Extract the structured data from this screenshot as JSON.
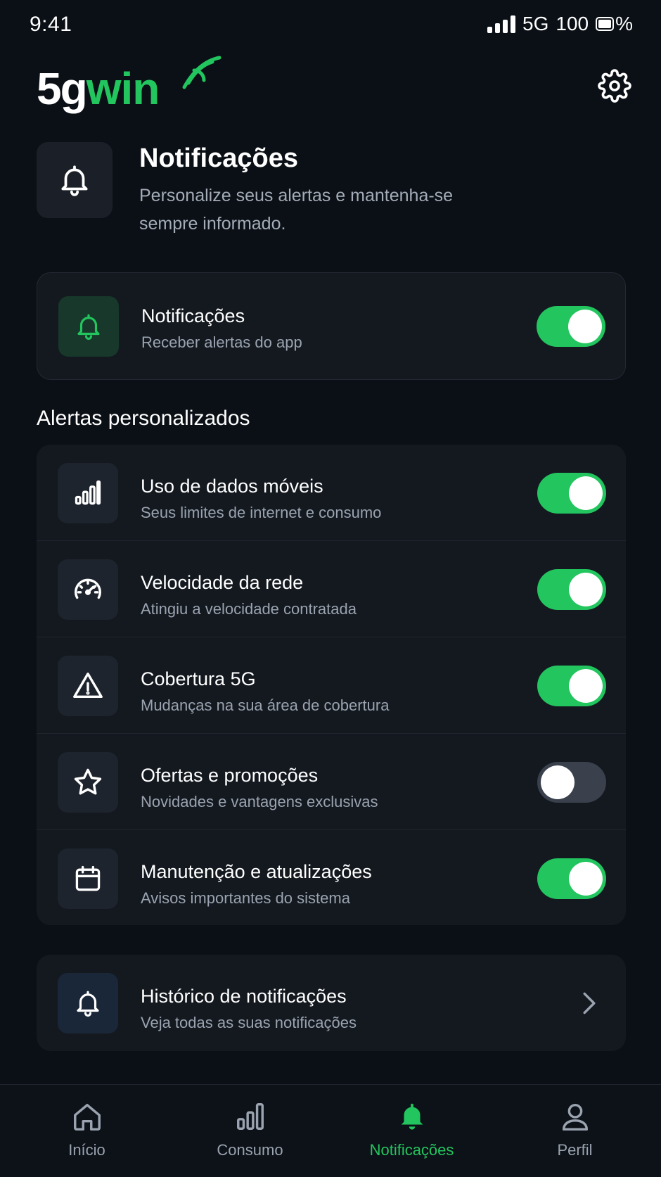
{
  "status_bar": {
    "time": "9:41",
    "network": "5G",
    "battery": "100",
    "battery_suffix": "%"
  },
  "brand": {
    "logo_part1": "5g",
    "logo_part2": "win",
    "accent_color": "#22c55e"
  },
  "header": {
    "title": "Notificações",
    "subtitle": "Personalize seus alertas e mantenha-se sempre informado."
  },
  "master": {
    "title": "Notificações",
    "subtitle": "Receber alertas do app",
    "enabled": true
  },
  "section_title": "Alertas personalizados",
  "alerts": [
    {
      "icon": "signal-bars-icon",
      "title": "Uso de dados móveis",
      "subtitle": "Seus limites de internet e consumo",
      "enabled": true
    },
    {
      "icon": "speedometer-icon",
      "title": "Velocidade da rede",
      "subtitle": "Atingiu a velocidade contratada",
      "enabled": true
    },
    {
      "icon": "warning-icon",
      "title": "Cobertura 5G",
      "subtitle": "Mudanças na sua área de cobertura",
      "enabled": true
    },
    {
      "icon": "star-icon",
      "title": "Ofertas e promoções",
      "subtitle": "Novidades e vantagens exclusivas",
      "enabled": false
    },
    {
      "icon": "calendar-icon",
      "title": "Manutenção e atualizações",
      "subtitle": "Avisos importantes do sistema",
      "enabled": true
    }
  ],
  "history": {
    "title": "Histórico de notificações",
    "subtitle": "Veja todas as suas notificações"
  },
  "nav": [
    {
      "label": "Início",
      "icon": "home-icon",
      "active": false
    },
    {
      "label": "Consumo",
      "icon": "bar-chart-icon",
      "active": false
    },
    {
      "label": "Notificações",
      "icon": "bell-icon",
      "active": true
    },
    {
      "label": "Perfil",
      "icon": "user-icon",
      "active": false
    }
  ]
}
